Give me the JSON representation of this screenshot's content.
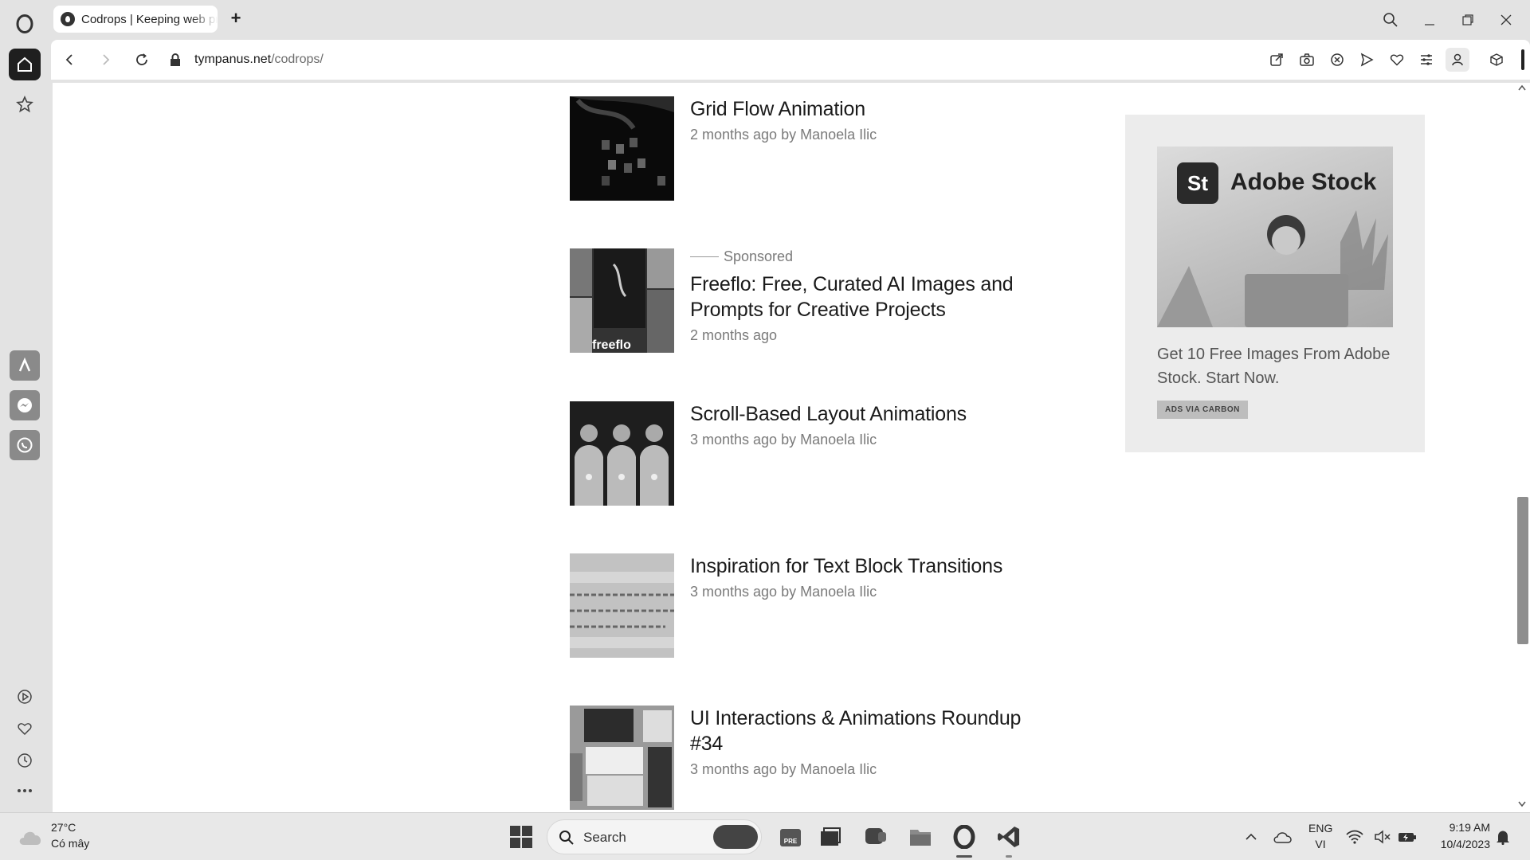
{
  "browser": {
    "tab_title": "Codrops | Keeping web pr",
    "url_host": "tympanus.net",
    "url_path": "/codrops/"
  },
  "articles": [
    {
      "title": "Grid Flow Animation",
      "meta": "2 months ago by Manoela Ilic",
      "sponsored": ""
    },
    {
      "title": "Freeflo: Free, Curated AI Images and Prompts for Creative Projects",
      "meta": "2 months ago",
      "sponsored": "Sponsored",
      "thumb_text": "freeflo"
    },
    {
      "title": "Scroll-Based Layout Animations",
      "meta": "3 months ago by Manoela Ilic",
      "sponsored": ""
    },
    {
      "title": "Inspiration for Text Block Transitions",
      "meta": "3 months ago by Manoela Ilic",
      "sponsored": ""
    },
    {
      "title": "UI Interactions & Animations Roundup #34",
      "meta": "3 months ago by Manoela Ilic",
      "sponsored": ""
    }
  ],
  "ad": {
    "brand_logo": "St",
    "brand_name": "Adobe Stock",
    "text": "Get 10 Free Images From Adobe Stock. Start Now.",
    "badge": "ADS VIA CARBON"
  },
  "taskbar": {
    "weather_temp": "27°C",
    "weather_desc": "Có mây",
    "search_label": "Search",
    "lang_top": "ENG",
    "lang_bottom": "VI",
    "time": "9:19 AM",
    "date": "10/4/2023"
  }
}
